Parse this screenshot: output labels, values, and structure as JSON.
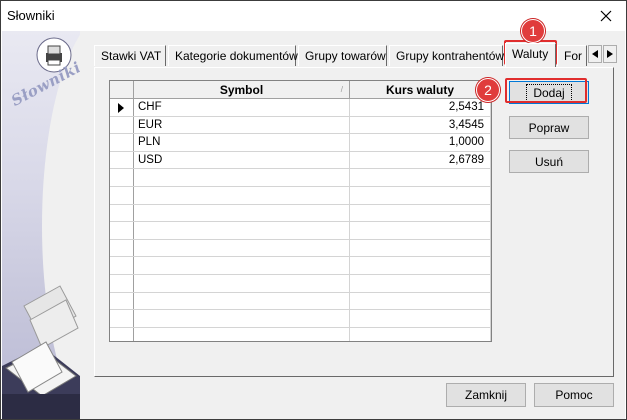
{
  "window": {
    "title": "Słowniki"
  },
  "sidebar": {
    "brand_label": "Słowniki"
  },
  "tabs": [
    {
      "label": "Stawki VAT",
      "active": false
    },
    {
      "label": "Kategorie dokumentów",
      "active": false
    },
    {
      "label": "Grupy towarów",
      "active": false
    },
    {
      "label": "Grupy kontrahentów",
      "active": false
    },
    {
      "label": "Waluty",
      "active": true
    },
    {
      "label": "For",
      "active": false
    }
  ],
  "grid": {
    "columns": {
      "symbol": "Symbol",
      "rate": "Kurs waluty"
    },
    "rows": [
      {
        "symbol": "CHF",
        "rate": "2,5431"
      },
      {
        "symbol": "EUR",
        "rate": "3,4545"
      },
      {
        "symbol": "PLN",
        "rate": "1,0000"
      },
      {
        "symbol": "USD",
        "rate": "2,6789"
      }
    ]
  },
  "actions": {
    "add": "Dodaj",
    "edit": "Popraw",
    "delete": "Usuń"
  },
  "footer": {
    "close": "Zamknij",
    "help": "Pomoc"
  },
  "annotations": {
    "step1": "1",
    "step2": "2",
    "color": "#e02d2d"
  }
}
